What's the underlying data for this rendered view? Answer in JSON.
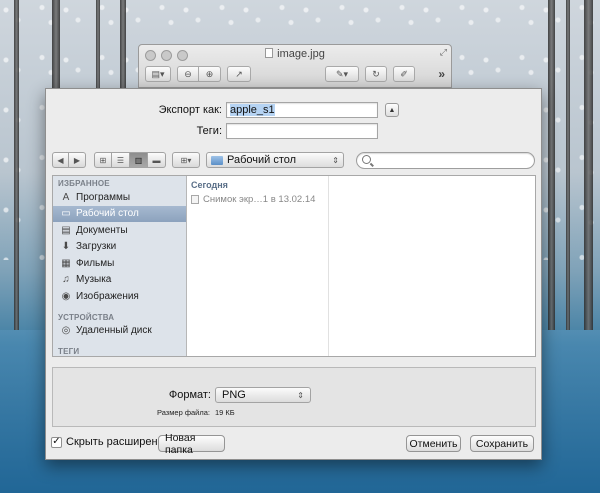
{
  "preview": {
    "title": "image.jpg",
    "toolbar": [
      "sidebar-toggle",
      "zoom-out",
      "zoom-in",
      "share",
      "edit",
      "rotate",
      "markup"
    ],
    "more": "»"
  },
  "save": {
    "export_label": "Экспорт как:",
    "filename_value": "apple_s1",
    "tags_label": "Теги:",
    "tags_value": ""
  },
  "nav": {
    "location": "Рабочий стол",
    "search_placeholder": ""
  },
  "sidebar": {
    "favorites_header": "ИЗБРАННОЕ",
    "favorites": [
      {
        "label": "Программы",
        "icon": "A"
      },
      {
        "label": "Рабочий стол",
        "icon": "▭"
      },
      {
        "label": "Документы",
        "icon": "▤"
      },
      {
        "label": "Загрузки",
        "icon": "⬇"
      },
      {
        "label": "Фильмы",
        "icon": "▦"
      },
      {
        "label": "Музыка",
        "icon": "♫"
      },
      {
        "label": "Изображения",
        "icon": "◉"
      }
    ],
    "devices_header": "УСТРОЙСТВА",
    "devices": [
      {
        "label": "Удаленный диск",
        "icon": "◎"
      }
    ],
    "tags_header": "ТЕГИ"
  },
  "browser": {
    "column_header": "Сегодня",
    "files": [
      {
        "name": "Снимок экр…1 в 13.02.14"
      }
    ]
  },
  "options": {
    "format_label": "Формат:",
    "format_value": "PNG",
    "filesize_label": "Размер файла:",
    "filesize_value": "19 КБ"
  },
  "bottom": {
    "hide_extension_label": "Скрыть расширение",
    "hide_extension_checked": true,
    "new_folder": "Новая папка",
    "cancel": "Отменить",
    "save": "Сохранить"
  }
}
